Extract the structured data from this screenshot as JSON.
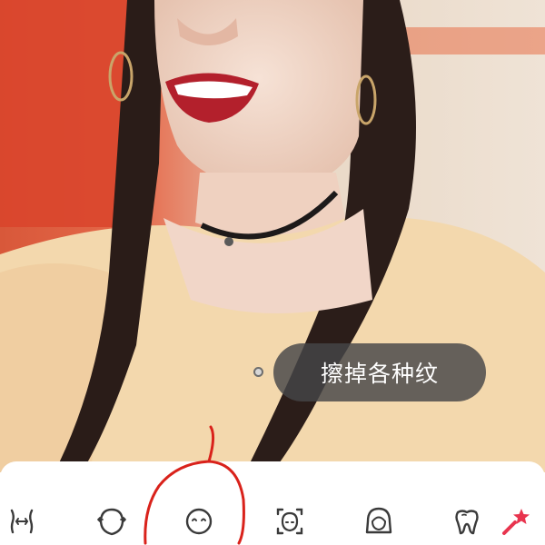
{
  "hint": {
    "text": "擦掉各种纹"
  },
  "toolbar": {
    "tools": [
      {
        "icon": "body-slim-icon"
      },
      {
        "icon": "face-reshape-icon"
      },
      {
        "icon": "smooth-face-icon"
      },
      {
        "icon": "face-frame-icon"
      },
      {
        "icon": "hair-icon"
      },
      {
        "icon": "tooth-icon"
      },
      {
        "icon": "magic-wand-icon"
      }
    ]
  },
  "colors": {
    "accent": "#e8344e",
    "icon": "#3a3a3a",
    "hint_bg": "#464648",
    "annotation": "#d9221b"
  }
}
